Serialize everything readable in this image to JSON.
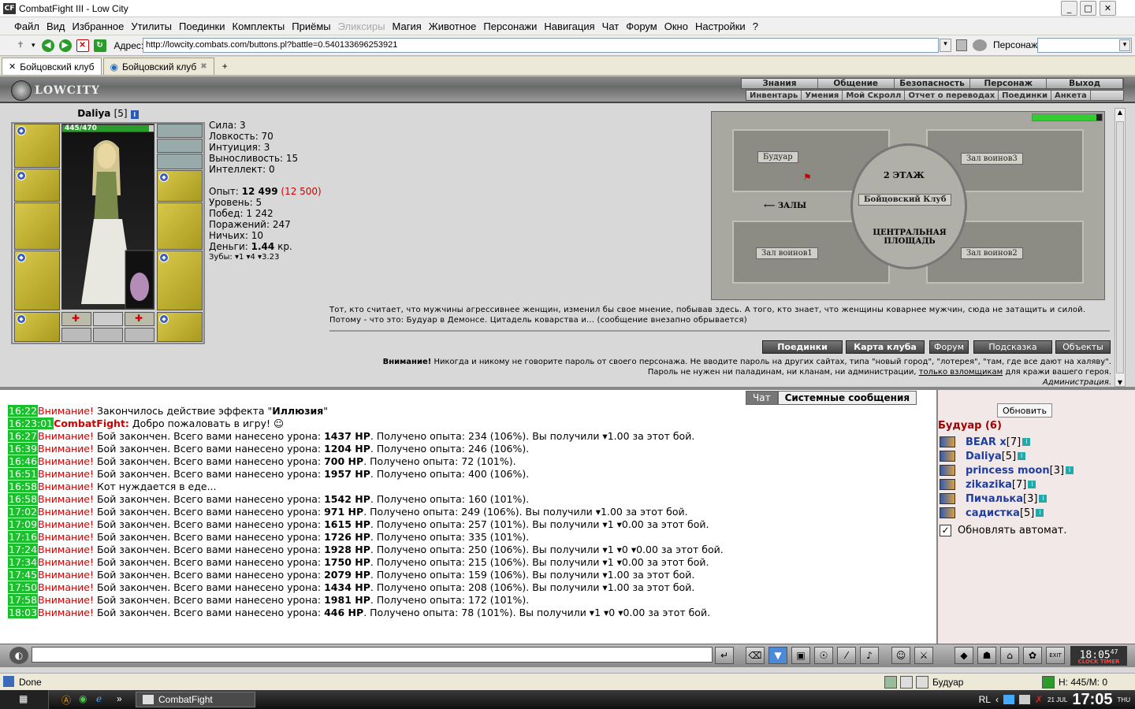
{
  "window": {
    "title": "CombatFight III - Low City",
    "icon_label": "CF"
  },
  "menu": [
    "Файл",
    "Вид",
    "Избранное",
    "Утилиты",
    "Поединки",
    "Комплекты",
    "Приёмы",
    "Эликсиры",
    "Магия",
    "Животное",
    "Персонажи",
    "Навигация",
    "Чат",
    "Форум",
    "Окно",
    "Настройки",
    "?"
  ],
  "menu_disabled": [
    "Эликсиры"
  ],
  "address": {
    "label": "Адрес:",
    "url": "http://lowcity.combats.com/buttons.pl?battle=0.540133696253921",
    "persona_label": "Персонаж:"
  },
  "tabs": [
    {
      "label": "Бойцовский клуб"
    },
    {
      "label": "Бойцовский клуб"
    }
  ],
  "header": {
    "logo": "LOWCITY",
    "nav_top": [
      "Знания",
      "Общение",
      "Безопасность",
      "Персонаж",
      "Выход"
    ],
    "nav_bottom": [
      "Инвентарь",
      "Умения",
      "Мой Скролл",
      "Отчет о переводах",
      "Поединки",
      "Анкета"
    ]
  },
  "character": {
    "name": "Daliya",
    "level": "[5]",
    "hp_text": "445/470",
    "hp_fraction": 0.947
  },
  "stats": {
    "strength": "Сила: 3",
    "agility": "Ловкость: 70",
    "intuition": "Интуиция: 3",
    "endurance": "Выносливость: 15",
    "intellect": "Интеллект: 0",
    "exp_label": "Опыт: ",
    "exp_value": "12 499",
    "exp_next": "(12 500)",
    "level": "Уровень: 5",
    "wins_label": "Побед: ",
    "wins": "1 242",
    "losses": "Поражений: 247",
    "draws": "Ничьих: 10",
    "money_label": "Деньги: ",
    "money_value": "1.44",
    "money_unit": " кр.",
    "teeth": "Зубы: ▾1 ▾4 ▾3.23"
  },
  "map": {
    "rooms": [
      "Будуар",
      "Зал воинов3",
      "Зал воинов1",
      "Зал воинов2"
    ],
    "floor_label": "2 ЭТАЖ",
    "club_label": "Бойцовский Клуб",
    "halls_label": "⟵ ЗАЛЫ",
    "central": "ЦЕНТРАЛЬНАЯ ПЛОЩАДЬ"
  },
  "description": "Тот, кто считает, что мужчины агрессивнее женщин, изменил бы свое мнение, побывав здесь. А того, кто знает, что женщины коварнее мужчин, сюда не затащить и силой. Потому - что это: Будуар в Демонсе. Цитадель коварства и... (сообщение внезапно обрывается)",
  "buttons": [
    "Поединки",
    "Карта клуба",
    "Форум",
    "Подсказка",
    "Объекты"
  ],
  "warning": {
    "bold": "Внимание!",
    "line1": " Никогда и никому не говорите пароль от своего персонажа. Не вводите пароль на других сайтах, типа \"новый город\", \"лотерея\", \"там, где все дают на халяву\".",
    "line2a": "Пароль не нужен ни паладинам, ни кланам, ни администрации, ",
    "line2link": "только взломщикам",
    "line2b": " для кражи вашего героя.",
    "sign": "Администрация."
  },
  "chat_tabs": [
    "Чат",
    "Системные сообщения"
  ],
  "chat": [
    {
      "time": "16:22",
      "who": "Внимание!",
      "text": " Закончилось действие эффекта \"",
      "bold": "Иллюзия",
      "tail": "\""
    },
    {
      "time": "16:23:01",
      "who": "CombatFight:",
      "text": " Добро пожаловать в игру! ☺",
      "bold": "",
      "tail": ""
    },
    {
      "time": "16:27",
      "who": "Внимание!",
      "text": " Бой закончен. Всего вами нанесено урона: ",
      "bold": "1437 HP",
      "tail": ". Получено опыта: 234 (106%). Вы получили ▾1.00 за этот бой."
    },
    {
      "time": "16:39",
      "who": "Внимание!",
      "text": " Бой закончен. Всего вами нанесено урона: ",
      "bold": "1204 HP",
      "tail": ". Получено опыта: 246 (106%)."
    },
    {
      "time": "16:46",
      "who": "Внимание!",
      "text": " Бой закончен. Всего вами нанесено урона: ",
      "bold": "700 HP",
      "tail": ". Получено опыта: 72 (101%)."
    },
    {
      "time": "16:51",
      "who": "Внимание!",
      "text": " Бой закончен. Всего вами нанесено урона: ",
      "bold": "1957 HP",
      "tail": ". Получено опыта: 400 (106%)."
    },
    {
      "time": "16:58",
      "who": "Внимание!",
      "text": " Кот нуждается в еде...",
      "bold": "",
      "tail": ""
    },
    {
      "time": "16:58",
      "who": "Внимание!",
      "text": " Бой закончен. Всего вами нанесено урона: ",
      "bold": "1542 HP",
      "tail": ". Получено опыта: 160 (101%)."
    },
    {
      "time": "17:02",
      "who": "Внимание!",
      "text": " Бой закончен. Всего вами нанесено урона: ",
      "bold": "971 HP",
      "tail": ". Получено опыта: 249 (106%). Вы получили ▾1.00 за этот бой."
    },
    {
      "time": "17:09",
      "who": "Внимание!",
      "text": " Бой закончен. Всего вами нанесено урона: ",
      "bold": "1615 HP",
      "tail": ". Получено опыта: 257 (101%). Вы получили ▾1 ▾0.00 за этот бой."
    },
    {
      "time": "17:16",
      "who": "Внимание!",
      "text": " Бой закончен. Всего вами нанесено урона: ",
      "bold": "1726 HP",
      "tail": ". Получено опыта: 335 (101%)."
    },
    {
      "time": "17:24",
      "who": "Внимание!",
      "text": " Бой закончен. Всего вами нанесено урона: ",
      "bold": "1928 HP",
      "tail": ". Получено опыта: 250 (106%). Вы получили ▾1 ▾0 ▾0.00 за этот бой."
    },
    {
      "time": "17:34",
      "who": "Внимание!",
      "text": " Бой закончен. Всего вами нанесено урона: ",
      "bold": "1750 HP",
      "tail": ". Получено опыта: 215 (106%). Вы получили ▾1 ▾0.00 за этот бой."
    },
    {
      "time": "17:45",
      "who": "Внимание!",
      "text": " Бой закончен. Всего вами нанесено урона: ",
      "bold": "2079 HP",
      "tail": ". Получено опыта: 159 (106%). Вы получили ▾1.00 за этот бой."
    },
    {
      "time": "17:50",
      "who": "Внимание!",
      "text": " Бой закончен. Всего вами нанесено урона: ",
      "bold": "1434 HP",
      "tail": ". Получено опыта: 208 (106%). Вы получили ▾1.00 за этот бой."
    },
    {
      "time": "17:58",
      "who": "Внимание!",
      "text": " Бой закончен. Всего вами нанесено урона: ",
      "bold": "1981 HP",
      "tail": ". Получено опыта: 172 (101%)."
    },
    {
      "time": "18:03",
      "who": "Внимание!",
      "text": " Бой закончен. Всего вами нанесено урона: ",
      "bold": "446 HP",
      "tail": ". Получено опыта: 78 (101%). Вы получили ▾1 ▾0 ▾0.00 за этот бой."
    }
  ],
  "room_panel": {
    "refresh": "Обновить",
    "title": "Будуар (6)",
    "players": [
      {
        "name": "BEAR x",
        "level": "[7]"
      },
      {
        "name": "Daliya",
        "level": "[5]"
      },
      {
        "name": "princess moon",
        "level": "[3]"
      },
      {
        "name": "zikazika",
        "level": "[7]"
      },
      {
        "name": "Пичалька",
        "level": "[3]"
      },
      {
        "name": "садистка",
        "level": "[5]"
      }
    ],
    "auto_refresh": "Обновлять автомат."
  },
  "clock": {
    "time": "18:05",
    "seconds": "47",
    "labels": "CLOCK TIMER",
    "exit": "EXIT"
  },
  "status": {
    "left": "Done",
    "location": "Будуар",
    "hpmp": "H: 445/M: 0"
  },
  "taskbar": {
    "window": "CombatFight",
    "lang": "RL",
    "date": "21 JUL",
    "time": "17:05",
    "day": "THU"
  },
  "colors": {
    "timestamp_bg": "#19c02c",
    "attention": "#d00000",
    "player_name": "#1f3e9e",
    "room_title": "#a00000"
  }
}
